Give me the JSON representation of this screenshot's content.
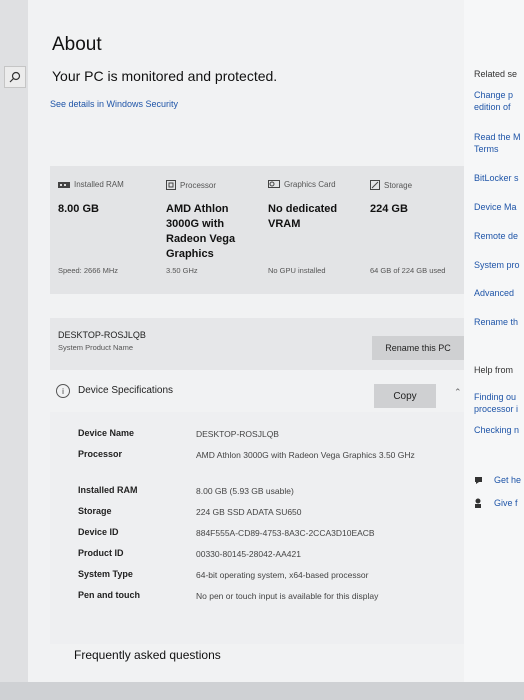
{
  "page": {
    "title": "About",
    "protection_status": "Your PC is monitored and protected.",
    "security_link": "See details in Windows Security",
    "faq_heading": "Frequently asked questions"
  },
  "spec_cards": [
    {
      "heading": "Installed RAM",
      "icon": "ram-icon",
      "value": "8.00 GB",
      "sub": "Speed: 2666 MHz"
    },
    {
      "heading": "Processor",
      "icon": "processor-icon",
      "value": "AMD Athlon 3000G with Radeon Vega Graphics",
      "sub": "3.50 GHz"
    },
    {
      "heading": "Graphics Card",
      "icon": "graphics-card-icon",
      "value": "No dedicated VRAM",
      "sub": "No GPU installed"
    },
    {
      "heading": "Storage",
      "icon": "storage-icon",
      "value": "224 GB",
      "sub": "64 GB of 224 GB used"
    }
  ],
  "device": {
    "name": "DESKTOP-ROSJLQB",
    "sub": "System Product Name",
    "rename_label": "Rename this PC"
  },
  "device_specs": {
    "title": "Device Specifications",
    "copy_label": "Copy",
    "rows": [
      {
        "label": "Device Name",
        "value": "DESKTOP-ROSJLQB"
      },
      {
        "label": "Processor",
        "value": "AMD Athlon 3000G with Radeon Vega Graphics 3.50 GHz"
      },
      {
        "label": "Installed RAM",
        "value": "8.00 GB (5.93 GB usable)"
      },
      {
        "label": "Storage",
        "value": "224 GB SSD ADATA SU650"
      },
      {
        "label": "Device ID",
        "value": "884F555A-CD89-4753-8A3C-2CCA3D10EACB"
      },
      {
        "label": "Product ID",
        "value": "00330-80145-28042-AA421"
      },
      {
        "label": "System Type",
        "value": "64-bit operating system, x64-based processor"
      },
      {
        "label": "Pen and touch",
        "value": "No pen or touch input is available for this display"
      }
    ]
  },
  "right_panel": {
    "related_heading": "Related se",
    "links": [
      "Change p",
      "edition of",
      "Read the M",
      "Terms",
      "BitLocker s",
      "Device Ma",
      "Remote de",
      "System pro",
      "Advanced",
      "Rename th"
    ],
    "help_heading": "Help from",
    "help_links": [
      "Finding ou",
      "processor i",
      "Checking n"
    ],
    "get_help": "Get he",
    "give_feedback": "Give f"
  }
}
